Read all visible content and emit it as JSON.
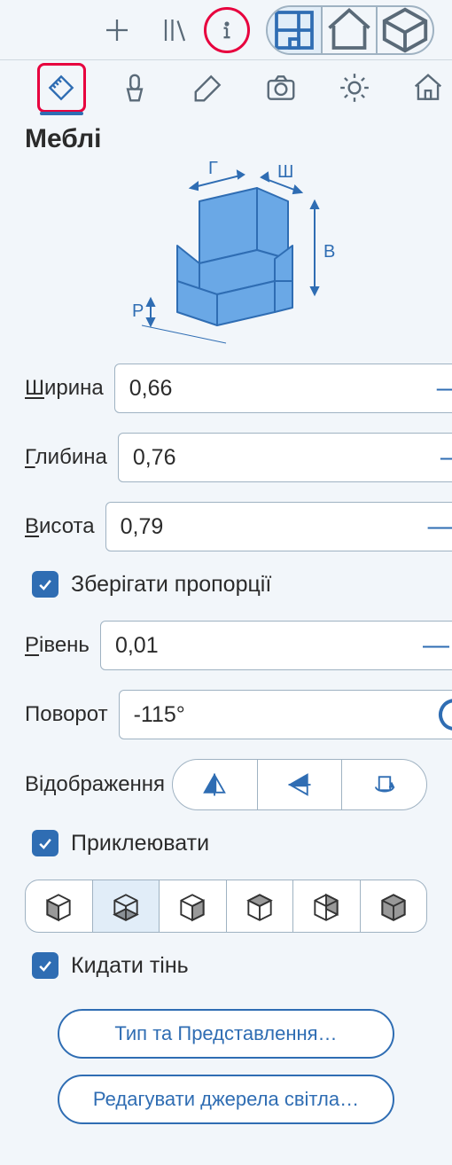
{
  "title": "Меблі",
  "diagram_labels": {
    "depth": "Г",
    "width": "Ш",
    "height": "В",
    "level": "Р"
  },
  "fields": {
    "width": {
      "label": "Ширина",
      "ul": "Ш",
      "rest": "ирина",
      "value": "0,66"
    },
    "depth": {
      "label": "Глибина",
      "ul": "Г",
      "rest": "либина",
      "value": "0,76"
    },
    "height": {
      "label": "Висота",
      "ul": "В",
      "rest": "исота",
      "value": "0,79"
    },
    "level": {
      "label": "Рівень",
      "ul": "Р",
      "rest": "івень",
      "value": "0,01"
    },
    "rotate": {
      "label": "Поворот",
      "value": "-115°"
    },
    "mirror": {
      "label": "Відображення"
    }
  },
  "checks": {
    "proportions": "Зберігати пропорції",
    "glue": "Приклеювати",
    "shadow": "Кидати тінь"
  },
  "buttons": {
    "type": "Тип та Представлення…",
    "light": "Редагувати джерела світла…"
  }
}
